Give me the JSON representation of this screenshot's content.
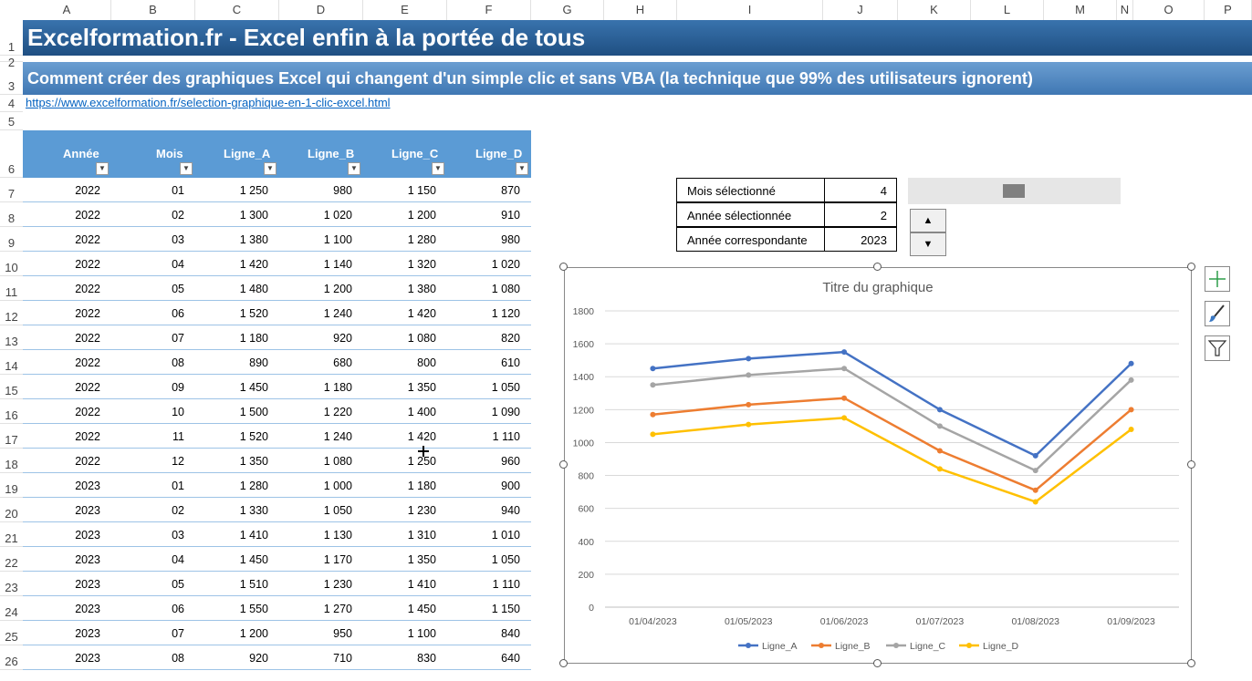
{
  "columns": [
    "A",
    "B",
    "C",
    "D",
    "E",
    "F",
    "G",
    "H",
    "I",
    "J",
    "K",
    "L",
    "M",
    "N",
    "O",
    "P"
  ],
  "rows": [
    "1",
    "2",
    "3",
    "4",
    "5",
    "6",
    "7",
    "8",
    "9",
    "10",
    "11",
    "12",
    "13",
    "14",
    "15",
    "16",
    "17",
    "18",
    "19",
    "20",
    "21",
    "22",
    "23",
    "24",
    "25",
    "26"
  ],
  "title": "Excelformation.fr - Excel enfin à la portée de tous",
  "subtitle": "Comment créer des graphiques Excel qui changent d'un simple clic et sans VBA (la technique que 99% des utilisateurs ignorent)",
  "link": "https://www.excelformation.fr/selection-graphique-en-1-clic-excel.html",
  "table": {
    "headers": [
      "Année",
      "Mois",
      "Ligne_A",
      "Ligne_B",
      "Ligne_C",
      "Ligne_D"
    ],
    "rows": [
      [
        "2022",
        "01",
        "1 250",
        "980",
        "1 150",
        "870"
      ],
      [
        "2022",
        "02",
        "1 300",
        "1 020",
        "1 200",
        "910"
      ],
      [
        "2022",
        "03",
        "1 380",
        "1 100",
        "1 280",
        "980"
      ],
      [
        "2022",
        "04",
        "1 420",
        "1 140",
        "1 320",
        "1 020"
      ],
      [
        "2022",
        "05",
        "1 480",
        "1 200",
        "1 380",
        "1 080"
      ],
      [
        "2022",
        "06",
        "1 520",
        "1 240",
        "1 420",
        "1 120"
      ],
      [
        "2022",
        "07",
        "1 180",
        "920",
        "1 080",
        "820"
      ],
      [
        "2022",
        "08",
        "890",
        "680",
        "800",
        "610"
      ],
      [
        "2022",
        "09",
        "1 450",
        "1 180",
        "1 350",
        "1 050"
      ],
      [
        "2022",
        "10",
        "1 500",
        "1 220",
        "1 400",
        "1 090"
      ],
      [
        "2022",
        "11",
        "1 520",
        "1 240",
        "1 420",
        "1 110"
      ],
      [
        "2022",
        "12",
        "1 350",
        "1 080",
        "1 250",
        "960"
      ],
      [
        "2023",
        "01",
        "1 280",
        "1 000",
        "1 180",
        "900"
      ],
      [
        "2023",
        "02",
        "1 330",
        "1 050",
        "1 230",
        "940"
      ],
      [
        "2023",
        "03",
        "1 410",
        "1 130",
        "1 310",
        "1 010"
      ],
      [
        "2023",
        "04",
        "1 450",
        "1 170",
        "1 350",
        "1 050"
      ],
      [
        "2023",
        "05",
        "1 510",
        "1 230",
        "1 410",
        "1 110"
      ],
      [
        "2023",
        "06",
        "1 550",
        "1 270",
        "1 450",
        "1 150"
      ],
      [
        "2023",
        "07",
        "1 200",
        "950",
        "1 100",
        "840"
      ],
      [
        "2023",
        "08",
        "920",
        "710",
        "830",
        "640"
      ]
    ]
  },
  "info": {
    "rows": [
      {
        "label": "Mois sélectionné",
        "value": "4"
      },
      {
        "label": "Année sélectionnée",
        "value": "2"
      },
      {
        "label": "Année correspondante",
        "value": "2023"
      }
    ]
  },
  "spin": {
    "up": "▲",
    "down": "▼"
  },
  "chart_data": {
    "type": "line",
    "title": "Titre du graphique",
    "categories": [
      "01/04/2023",
      "01/05/2023",
      "01/06/2023",
      "01/07/2023",
      "01/08/2023",
      "01/09/2023"
    ],
    "ylim": [
      0,
      1800
    ],
    "yticks": [
      "0",
      "200",
      "400",
      "600",
      "800",
      "1000",
      "1200",
      "1400",
      "1600",
      "1800"
    ],
    "grid": true,
    "legend": "bottom",
    "series": [
      {
        "name": "Ligne_A",
        "color": "#4472c4",
        "values": [
          1450,
          1510,
          1550,
          1200,
          920,
          1480
        ]
      },
      {
        "name": "Ligne_B",
        "color": "#ed7d31",
        "values": [
          1170,
          1230,
          1270,
          950,
          710,
          1200
        ]
      },
      {
        "name": "Ligne_C",
        "color": "#a5a5a5",
        "values": [
          1350,
          1410,
          1450,
          1100,
          830,
          1380
        ]
      },
      {
        "name": "Ligne_D",
        "color": "#ffc000",
        "values": [
          1050,
          1110,
          1150,
          840,
          640,
          1080
        ]
      }
    ]
  }
}
